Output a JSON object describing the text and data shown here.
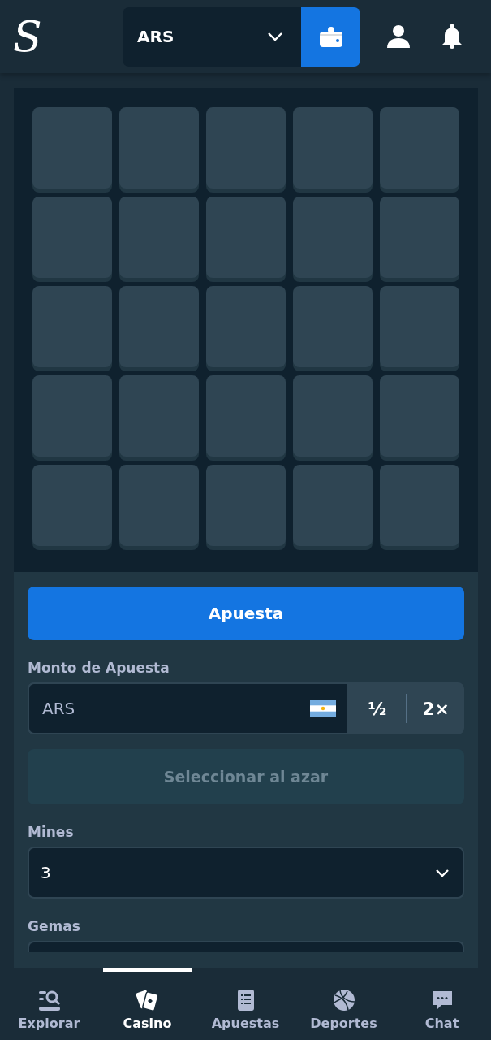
{
  "header": {
    "logo": "S",
    "currency": {
      "value": "ARS"
    }
  },
  "game": {
    "tiles": [
      {
        "revealed": false
      },
      {
        "revealed": false
      },
      {
        "revealed": false
      },
      {
        "revealed": false
      },
      {
        "revealed": false
      },
      {
        "revealed": false
      },
      {
        "revealed": false
      },
      {
        "revealed": false
      },
      {
        "revealed": false
      },
      {
        "revealed": false
      },
      {
        "revealed": false
      },
      {
        "revealed": false
      },
      {
        "revealed": false
      },
      {
        "revealed": false
      },
      {
        "revealed": false
      },
      {
        "revealed": false
      },
      {
        "revealed": false
      },
      {
        "revealed": false
      },
      {
        "revealed": false
      },
      {
        "revealed": false
      },
      {
        "revealed": false
      },
      {
        "revealed": false
      },
      {
        "revealed": false
      },
      {
        "revealed": false
      },
      {
        "revealed": false
      }
    ]
  },
  "controls": {
    "bet_button": "Apuesta",
    "amount_label": "Monto de Apuesta",
    "amount_placeholder": "ARS",
    "half_button": "½",
    "double_button": "2×",
    "random_button": {
      "label": "Seleccionar al azar",
      "disabled": true
    },
    "mines_label": "Mines",
    "mines_value": "3",
    "gems_label": "Gemas"
  },
  "bottom_nav": [
    {
      "label": "Explorar",
      "kind": "explore",
      "selected": false
    },
    {
      "label": "Casino",
      "kind": "casino",
      "selected": true
    },
    {
      "label": "Apuestas",
      "kind": "bets",
      "selected": false
    },
    {
      "label": "Deportes",
      "kind": "sports",
      "selected": false
    },
    {
      "label": "Chat",
      "kind": "chat",
      "selected": false
    }
  ]
}
